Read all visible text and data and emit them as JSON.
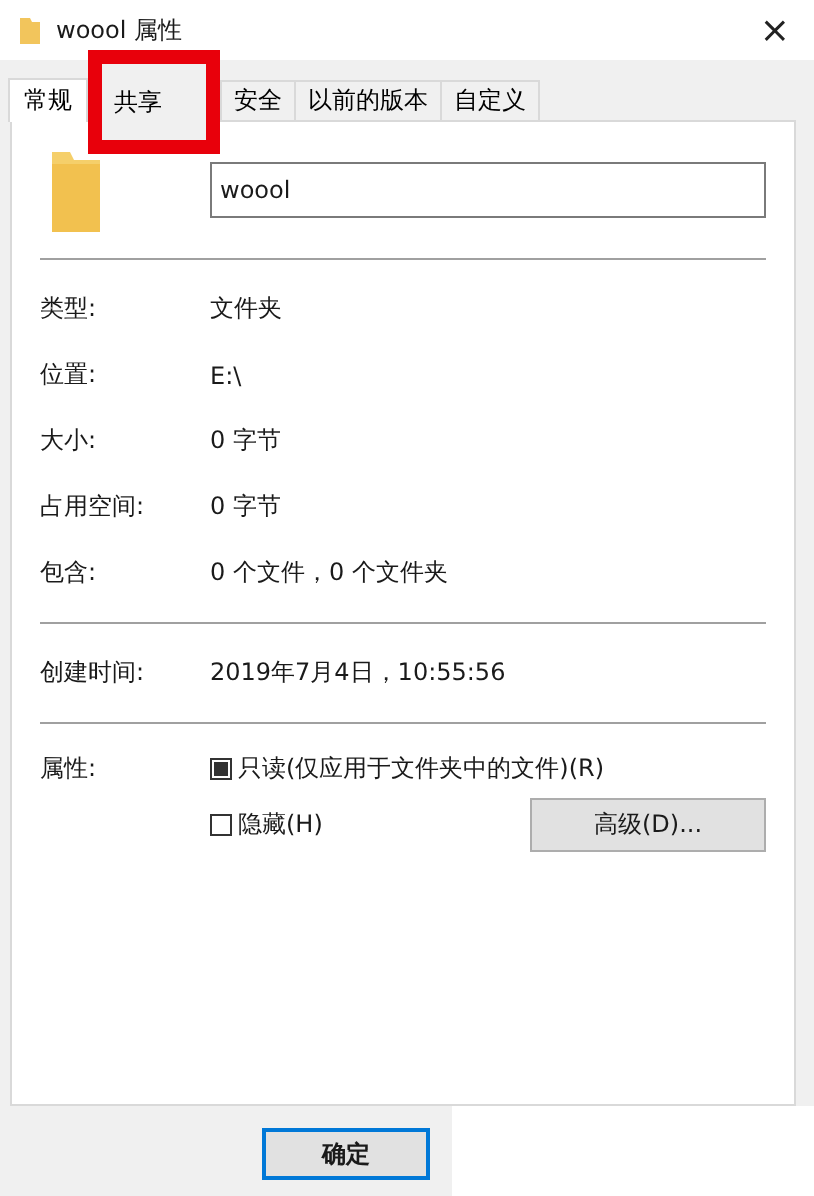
{
  "window": {
    "title": "woool 属性",
    "close": "×"
  },
  "tabs": [
    {
      "label": "常规",
      "selected": true
    },
    {
      "label": "共享",
      "selected": false,
      "highlighted": true
    },
    {
      "label": "安全",
      "selected": false,
      "highlighted": false
    },
    {
      "label": "以前的版本",
      "selected": false,
      "highlighted": false
    },
    {
      "label": "自定义",
      "selected": false,
      "highlighted": false
    }
  ],
  "name_field": {
    "value": "woool"
  },
  "info_groups": [
    [
      {
        "label": "类型:",
        "value": "文件夹"
      },
      {
        "label": "位置:",
        "value": "E:\\"
      },
      {
        "label": "大小:",
        "value": "0 字节"
      },
      {
        "label": "占用空间:",
        "value": "0 字节"
      },
      {
        "label": "包含:",
        "value": "0 个文件，0 个文件夹"
      }
    ],
    [
      {
        "label": "创建时间:",
        "value": "2019年7月4日，10:55:56"
      }
    ]
  ],
  "attributes": {
    "label": "属性:",
    "checkboxes": [
      {
        "label": "只读(仅应用于文件夹中的文件)(R)",
        "checked": false,
        "indeterminate": true
      },
      {
        "label": "隐藏(H)",
        "checked": false,
        "indeterminate": false
      }
    ],
    "advanced_button": "高级(D)..."
  },
  "buttons": [
    {
      "label": "确定",
      "default": true
    }
  ]
}
